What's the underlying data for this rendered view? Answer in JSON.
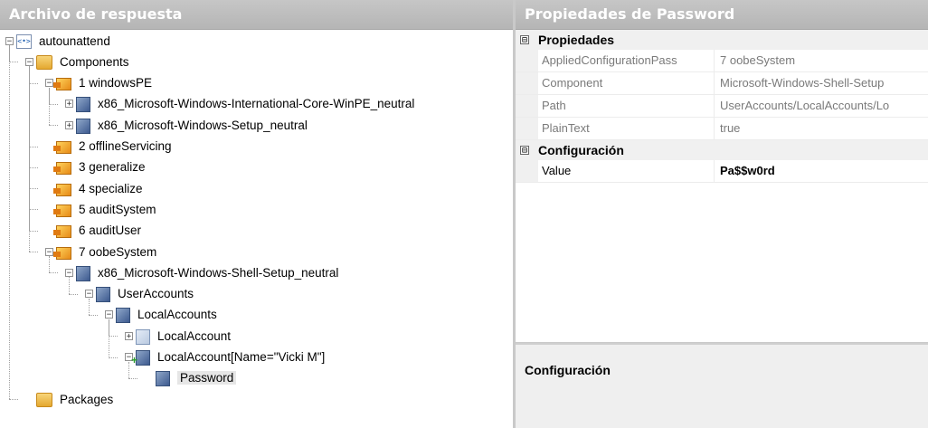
{
  "left_panel": {
    "title": "Archivo de respuesta"
  },
  "right_panel": {
    "title": "Propiedades de Password"
  },
  "tree": [
    {
      "label": "autounattend",
      "icon": "xml-file-icon",
      "expander": "−"
    },
    {
      "label": "Components",
      "icon": "folder-icon",
      "expander": "−"
    },
    {
      "label": "1 windowsPE",
      "icon": "config-pass-icon",
      "expander": "−"
    },
    {
      "label": "x86_Microsoft-Windows-International-Core-WinPE_neutral",
      "icon": "component-icon",
      "expander": "+"
    },
    {
      "label": "x86_Microsoft-Windows-Setup_neutral",
      "icon": "component-icon",
      "expander": "+"
    },
    {
      "label": "2 offlineServicing",
      "icon": "config-pass-icon",
      "expander": ""
    },
    {
      "label": "3 generalize",
      "icon": "config-pass-icon",
      "expander": ""
    },
    {
      "label": "4 specialize",
      "icon": "config-pass-icon",
      "expander": ""
    },
    {
      "label": "5 auditSystem",
      "icon": "config-pass-icon",
      "expander": ""
    },
    {
      "label": "6 auditUser",
      "icon": "config-pass-icon",
      "expander": ""
    },
    {
      "label": "7 oobeSystem",
      "icon": "config-pass-icon",
      "expander": "−"
    },
    {
      "label": "x86_Microsoft-Windows-Shell-Setup_neutral",
      "icon": "component-icon",
      "expander": "−"
    },
    {
      "label": "UserAccounts",
      "icon": "component-icon",
      "expander": "−"
    },
    {
      "label": "LocalAccounts",
      "icon": "component-icon",
      "expander": "−"
    },
    {
      "label": "LocalAccount",
      "icon": "component-light-icon",
      "expander": "+"
    },
    {
      "label": "LocalAccount[Name=\"Vicki M\"]",
      "icon": "component-add-icon",
      "expander": "−"
    },
    {
      "label": "Password",
      "icon": "component-icon",
      "expander": ""
    },
    {
      "label": "Packages",
      "icon": "folder-icon",
      "expander": ""
    }
  ],
  "properties": {
    "category1": "Propiedades",
    "rows1": [
      {
        "key": "AppliedConfigurationPass",
        "value": "7 oobeSystem"
      },
      {
        "key": "Component",
        "value": "Microsoft-Windows-Shell-Setup"
      },
      {
        "key": "Path",
        "value": "UserAccounts/LocalAccounts/Lo"
      },
      {
        "key": "PlainText",
        "value": "true"
      }
    ],
    "category2": "Configuración",
    "rows2": [
      {
        "key": "Value",
        "value": "Pa$$w0rd"
      }
    ],
    "toggle_symbol": "⊟"
  },
  "description": {
    "title": "Configuración"
  }
}
